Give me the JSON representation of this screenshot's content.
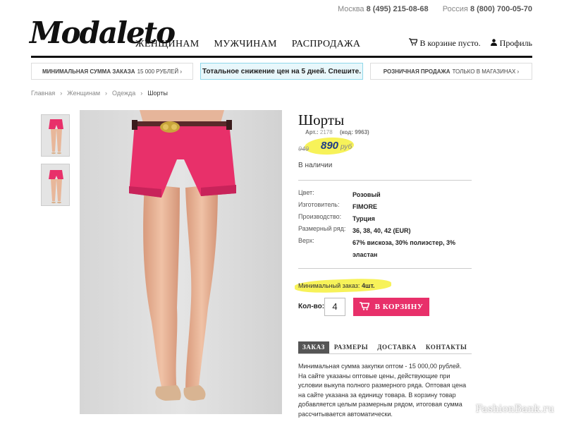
{
  "contacts": {
    "city1": "Москва",
    "phone1": "8 (495) 215-08-68",
    "city2": "Россия",
    "phone2": "8 (800) 700-05-70"
  },
  "header": {
    "logo": "Modaleto",
    "nav": [
      "ЖЕНЩИНАМ",
      "МУЖЧИНАМ",
      "РАСПРОДАЖА"
    ],
    "cart_text": "В корзине пусто.",
    "profile": "Профиль"
  },
  "promos": {
    "p1_bold": "Минимальная сумма заказа",
    "p1_rest": "15 000 рублей ›",
    "p2": "Тотальное снижение цен на 5 дней. Спешите.",
    "p3_bold": "Розничная продажа",
    "p3_rest": "только в магазинах ›"
  },
  "breadcrumb": [
    "Главная",
    "›",
    "Женщинам",
    "›",
    "Одежда",
    "›",
    "Шорты"
  ],
  "product": {
    "title": "Шорты",
    "art_label": "Арт.:",
    "art": "2178",
    "code": "(код: 9963)",
    "old_price": "949",
    "price": "890",
    "currency": "руб",
    "stock": "В наличии",
    "props": [
      {
        "k": "Цвет:",
        "v": "Розовый"
      },
      {
        "k": "Изготовитель:",
        "v": "FIMORE"
      },
      {
        "k": "Производство:",
        "v": "Турция"
      },
      {
        "k": "Размерный ряд:",
        "v": "36, 38, 40, 42 (EUR)"
      },
      {
        "k": "Верх:",
        "v": "67% вискоза, 30% полиэстер, 3% эластан"
      }
    ],
    "min_order_label": "Минимальный заказ:",
    "min_order_value": "4шт.",
    "qty_label": "Кол-во:",
    "qty_value": "4",
    "cart_button": "В КОРЗИНУ"
  },
  "tabs": [
    "ЗАКАЗ",
    "РАЗМЕРЫ",
    "ДОСТАВКА",
    "КОНТАКТЫ"
  ],
  "tab_body": "Минимальная сумма закупки оптом - 15 000,00 рублей. На сайте указаны оптовые цены, действующие при условии выкупа полного размерного ряда. Оптовая цена на сайте указана за единицу товара. В корзину товар добавляется целым размерным рядом, итоговая сумма рассчитывается автоматически.",
  "watermark": "FashionBank.ru",
  "colors": {
    "accent": "#e8306a",
    "price": "#1c3a88",
    "highlight": "#f6f03c",
    "promo_bg": "#e8f7fb"
  }
}
